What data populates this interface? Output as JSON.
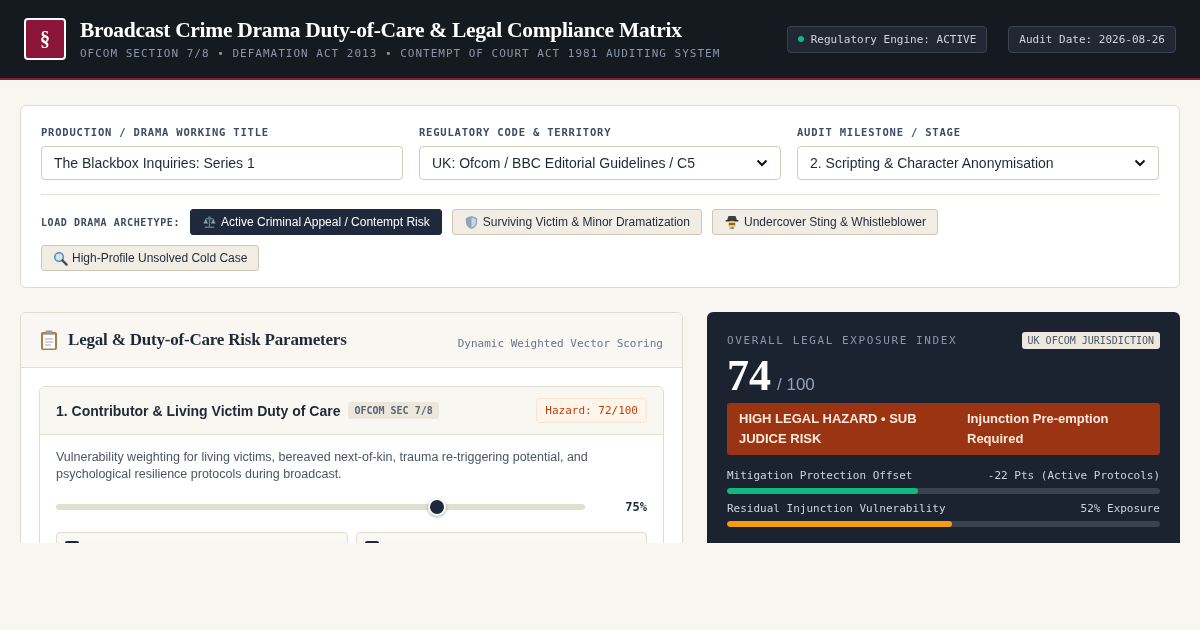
{
  "header": {
    "logo": "§",
    "title": "Broadcast Crime Drama Duty-of-Care & Legal Compliance Matrix",
    "subtitle": "OFCOM SECTION 7/8 • DEFAMATION ACT 2013 • CONTEMPT OF COURT ACT 1981 AUDITING SYSTEM",
    "badges": [
      {
        "kind": "status",
        "text": "Regulatory Engine: ACTIVE"
      },
      {
        "kind": "plain",
        "text": "Audit Date: 2026-08-26"
      }
    ]
  },
  "config": {
    "fields": [
      {
        "kind": "text",
        "label": "PRODUCTION / DRAMA WORKING TITLE",
        "value": "The Blackbox Inquiries: Series 1"
      },
      {
        "kind": "select",
        "label": "REGULATORY CODE & TERRITORY",
        "value": "UK: Ofcom / BBC Editorial Guidelines / C5"
      },
      {
        "kind": "select",
        "label": "AUDIT MILESTONE / STAGE",
        "value": "2. Scripting & Character Anonymisation"
      }
    ],
    "archetypes": {
      "label": "LOAD DRAMA ARCHETYPE:",
      "items": [
        {
          "label": "Active Criminal Appeal / Contempt Risk",
          "selected": true
        },
        {
          "label": "Surviving Victim & Minor Dramatization",
          "selected": false
        },
        {
          "label": "Undercover Sting & Whistleblower",
          "selected": false
        },
        {
          "label": "High-Profile Unsolved Cold Case",
          "selected": false
        }
      ]
    }
  },
  "parameters": {
    "title": "Legal & Duty-of-Care Risk Parameters",
    "subtitle": "Dynamic Weighted Vector Scoring",
    "sections": [
      {
        "title": "1. Contributor & Living Victim Duty of Care",
        "tag": "OFCOM SEC 7/8",
        "hazard": "Hazard: 72/100",
        "description": "Vulnerability weighting for living victims, bereaved next-of-kin, trauma re-triggering potential, and psychological resilience protocols during broadcast.",
        "slider": {
          "level": 0.72,
          "reading": "75%"
        },
        "options": [
          {
            "checked": true
          },
          {
            "checked": true
          }
        ]
      }
    ]
  },
  "exposure": {
    "label": "OVERALL LEGAL EXPOSURE INDEX",
    "jurisdiction": "UK OFCOM JURISDICTION",
    "score": "74",
    "max": "/ 100",
    "alert": {
      "status": "HIGH LEGAL HAZARD • SUB JUDICE RISK",
      "action": "Injunction Pre-emption Required"
    },
    "meters": [
      {
        "label": "Mitigation Protection Offset",
        "reading": "-22 Pts (Active Protocols)",
        "level": 0.44,
        "color": "#10b981"
      },
      {
        "label": "Residual Injunction Vulnerability",
        "reading": "52% Exposure",
        "level": 0.52,
        "color": "#f59e0b"
      }
    ]
  }
}
